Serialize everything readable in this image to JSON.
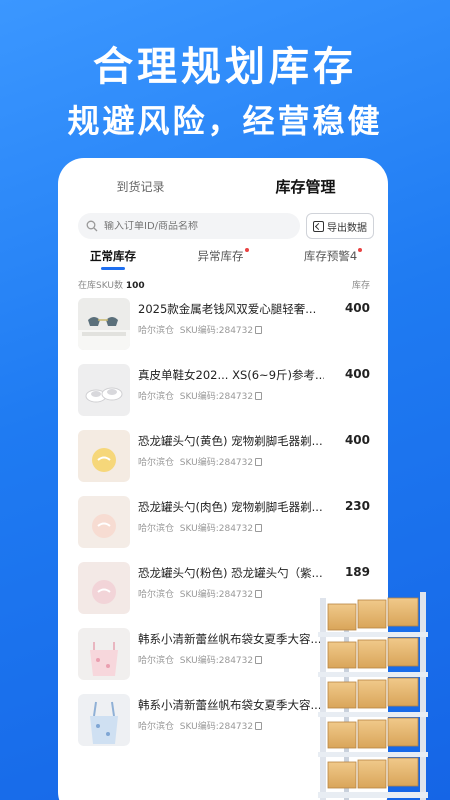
{
  "hero": {
    "title": "合理规划库存",
    "subtitle": "规避风险，经营稳健"
  },
  "top_tabs": [
    {
      "label": "到货记录",
      "active": false
    },
    {
      "label": "库存管理",
      "active": true
    }
  ],
  "search": {
    "placeholder": "输入订单ID/商品名称",
    "icon": "search-icon"
  },
  "export_button": {
    "label": "导出数据",
    "icon": "export-icon"
  },
  "sub_tabs": [
    {
      "label": "正常库存",
      "active": true,
      "dot": false
    },
    {
      "label": "异常库存",
      "active": false,
      "dot": true
    },
    {
      "label": "库存预警4",
      "active": false,
      "dot": true
    }
  ],
  "summary": {
    "sku_label": "在库SKU数",
    "sku_count": "100",
    "stock_label": "库存"
  },
  "products": [
    {
      "name": "2025款金属老钱风双爱心腿轻奢...",
      "warehouse": "哈尔滨仓",
      "sku": "SKU编码:284732",
      "qty": "400",
      "thumb": "sunglasses"
    },
    {
      "name": "真皮单鞋女202... XS(6~9斤)参考...",
      "warehouse": "哈尔滨仓",
      "sku": "SKU编码:284732",
      "qty": "400",
      "thumb": "shoes"
    },
    {
      "name": "恐龙罐头勺(黄色) 宠物剃脚毛器剃...",
      "warehouse": "哈尔滨仓",
      "sku": "SKU编码:284732",
      "qty": "400",
      "thumb": "yellow"
    },
    {
      "name": "恐龙罐头勺(肉色) 宠物剃脚毛器剃...",
      "warehouse": "哈尔滨仓",
      "sku": "SKU编码:284732",
      "qty": "230",
      "thumb": "beige"
    },
    {
      "name": "恐龙罐头勺(粉色) 恐龙罐头勺（紫...",
      "warehouse": "哈尔滨仓",
      "sku": "SKU编码:284732",
      "qty": "189",
      "thumb": "pink"
    },
    {
      "name": "韩系小清新蕾丝帆布袋女夏季大容...",
      "warehouse": "哈尔滨仓",
      "sku": "SKU编码:284732",
      "qty": "",
      "thumb": "bag-pink"
    },
    {
      "name": "韩系小清新蕾丝帆布袋女夏季大容...",
      "warehouse": "哈尔滨仓",
      "sku": "SKU编码:284732",
      "qty": "",
      "thumb": "bag-blue"
    }
  ],
  "colors": {
    "accent": "#1f6ff0",
    "background": "#1f7bf2",
    "alert_dot": "#e94343"
  }
}
